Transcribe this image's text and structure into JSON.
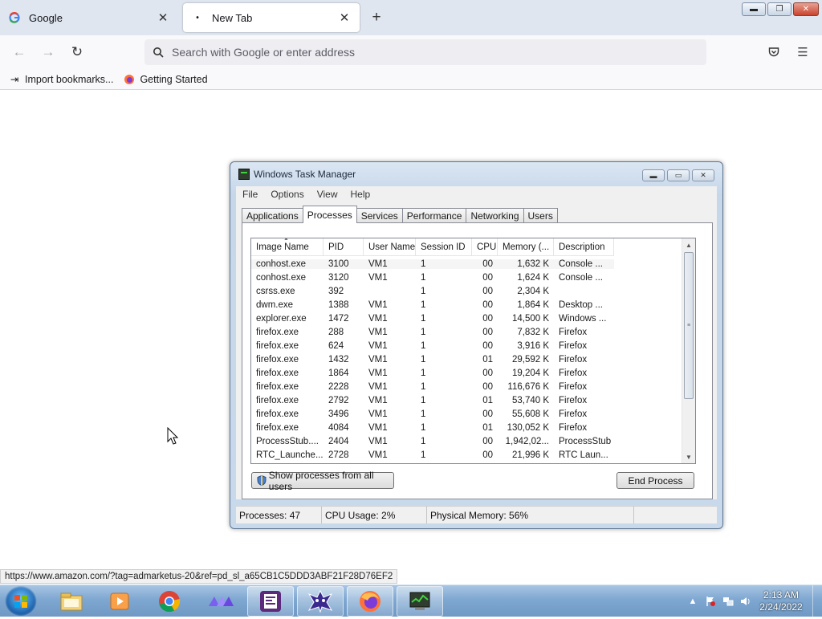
{
  "browser": {
    "tabs": [
      {
        "title": "Google",
        "favicon": "google-g-icon",
        "active": false
      },
      {
        "title": "New Tab",
        "favicon": "dot-icon",
        "active": true
      }
    ],
    "new_tab_label": "+",
    "url_placeholder": "Search with Google or enter address",
    "bookmarks": [
      {
        "label": "Import bookmarks...",
        "icon": "import-icon"
      },
      {
        "label": "Getting Started",
        "icon": "firefox-icon"
      }
    ],
    "status_url": "https://www.amazon.com/?tag=admarketus-20&ref=pd_sl_a65CB1C5DDD3ABF21F28D76EF2"
  },
  "taskmgr": {
    "title": "Windows Task Manager",
    "menu": [
      "File",
      "Options",
      "View",
      "Help"
    ],
    "tabs": [
      "Applications",
      "Processes",
      "Services",
      "Performance",
      "Networking",
      "Users"
    ],
    "active_tab": "Processes",
    "columns": [
      "Image Name",
      "PID",
      "User Name",
      "Session ID",
      "CPU",
      "Memory (...",
      "Description"
    ],
    "rows": [
      [
        "conhost.exe",
        "3100",
        "VM1",
        "1",
        "00",
        "1,632 K",
        "Console ..."
      ],
      [
        "conhost.exe",
        "3120",
        "VM1",
        "1",
        "00",
        "1,624 K",
        "Console ..."
      ],
      [
        "csrss.exe",
        "392",
        "",
        "1",
        "00",
        "2,304 K",
        ""
      ],
      [
        "dwm.exe",
        "1388",
        "VM1",
        "1",
        "00",
        "1,864 K",
        "Desktop ..."
      ],
      [
        "explorer.exe",
        "1472",
        "VM1",
        "1",
        "00",
        "14,500 K",
        "Windows ..."
      ],
      [
        "firefox.exe",
        "288",
        "VM1",
        "1",
        "00",
        "7,832 K",
        "Firefox"
      ],
      [
        "firefox.exe",
        "624",
        "VM1",
        "1",
        "00",
        "3,916 K",
        "Firefox"
      ],
      [
        "firefox.exe",
        "1432",
        "VM1",
        "1",
        "01",
        "29,592 K",
        "Firefox"
      ],
      [
        "firefox.exe",
        "1864",
        "VM1",
        "1",
        "00",
        "19,204 K",
        "Firefox"
      ],
      [
        "firefox.exe",
        "2228",
        "VM1",
        "1",
        "00",
        "116,676 K",
        "Firefox"
      ],
      [
        "firefox.exe",
        "2792",
        "VM1",
        "1",
        "01",
        "53,740 K",
        "Firefox"
      ],
      [
        "firefox.exe",
        "3496",
        "VM1",
        "1",
        "00",
        "55,608 K",
        "Firefox"
      ],
      [
        "firefox.exe",
        "4084",
        "VM1",
        "1",
        "01",
        "130,052 K",
        "Firefox"
      ],
      [
        "ProcessStub....",
        "2404",
        "VM1",
        "1",
        "00",
        "1,942,02...",
        "ProcessStub"
      ],
      [
        "RTC_Launche...",
        "2728",
        "VM1",
        "1",
        "00",
        "21,996 K",
        "RTC Laun..."
      ]
    ],
    "show_all_label": "Show processes from all users",
    "end_process_label": "End Process",
    "status": {
      "processes": "Processes: 47",
      "cpu": "CPU Usage: 2%",
      "memory": "Physical Memory: 56%"
    }
  },
  "taskbar": {
    "apps": [
      "explorer-icon",
      "media-player-icon",
      "chrome-icon",
      "app-purple-icon",
      "editor-icon",
      "game-icon",
      "firefox-icon",
      "task-manager-icon"
    ],
    "time": "2:13 AM",
    "date": "2/24/2022"
  }
}
